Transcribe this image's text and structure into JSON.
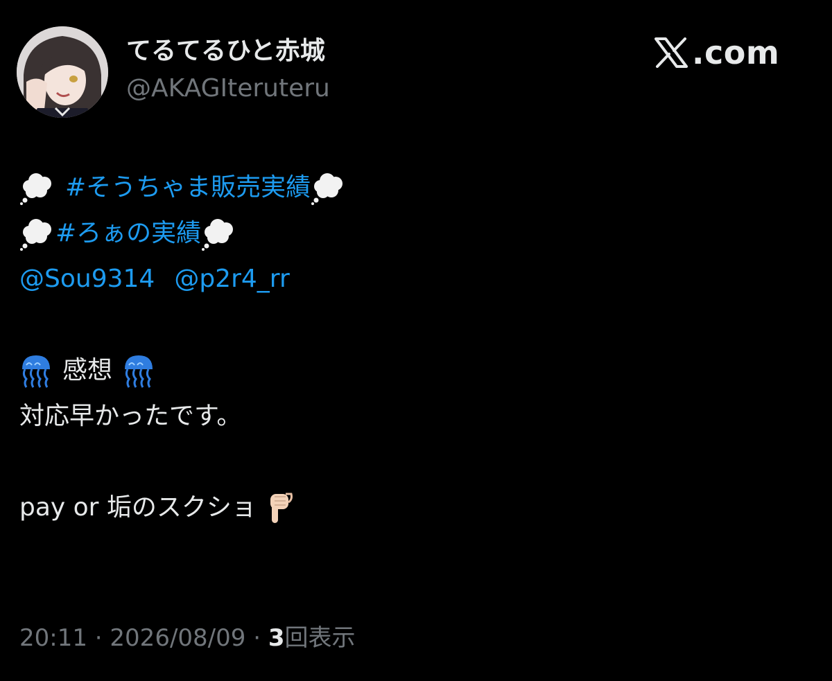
{
  "author": {
    "display_name": "てるてるひと赤城",
    "handle": "@AKAGIteruteru"
  },
  "brand": {
    "logo_icon": "x-logo-icon",
    "domain_suffix": ".com"
  },
  "tweet": {
    "hashtag_1": "#そうちゃま販売実績",
    "hashtag_2": "#ろぁの実績",
    "mention_1": "@Sou9314",
    "mention_2": "@p2r4_rr",
    "section_label": "感想",
    "comment": "対応早かったです。",
    "closing_text": "pay or 垢のスクショ",
    "emojis": {
      "thought": "thought-balloon-icon",
      "jellyfish": "jellyfish-icon",
      "point_down": "pointing-down-icon"
    }
  },
  "meta": {
    "time": "20:11",
    "separator": "·",
    "date": "2026/08/09",
    "view_count": "3",
    "view_label": "回表示"
  },
  "colors": {
    "background": "#000000",
    "text": "#e7e9ea",
    "secondary": "#71767b",
    "link": "#1d9bf0"
  }
}
